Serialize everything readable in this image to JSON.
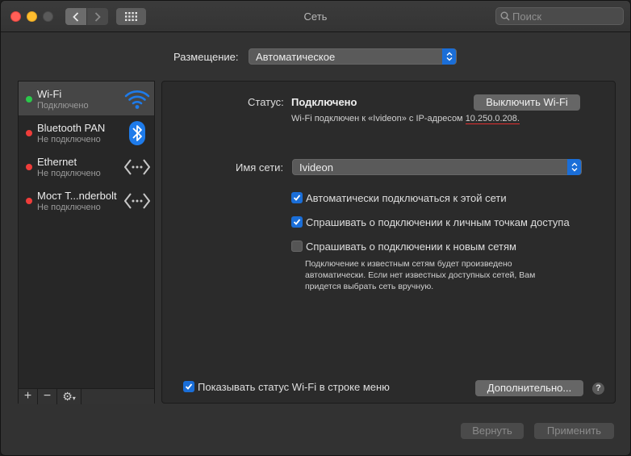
{
  "window": {
    "title": "Сеть"
  },
  "search": {
    "placeholder": "Поиск"
  },
  "location": {
    "label": "Размещение:",
    "value": "Автоматическое"
  },
  "sidebar": {
    "items": [
      {
        "name": "Wi-Fi",
        "status": "Подключено",
        "status_color": "#2ac94a",
        "icon": "wifi-icon"
      },
      {
        "name": "Bluetooth PAN",
        "status": "Не подключено",
        "status_color": "#ef3d3a",
        "icon": "bluetooth-icon"
      },
      {
        "name": "Ethernet",
        "status": "Не подключено",
        "status_color": "#ef3d3a",
        "icon": "ethernet-arrows-icon"
      },
      {
        "name": "Мост T...nderbolt",
        "status": "Не подключено",
        "status_color": "#ef3d3a",
        "icon": "thunderbolt-bridge-arrows-icon"
      }
    ],
    "add_label": "+",
    "remove_label": "−",
    "gear_label": "⚙"
  },
  "detail": {
    "status_label": "Статус:",
    "status_value": "Подключено",
    "toggle_button": "Выключить Wi-Fi",
    "status_desc": "Wi-Fi подключен к «Ivideon» с IP-адресом",
    "ip_address": "10.250.0.208",
    "ip_suffix": ".",
    "network_label": "Имя сети:",
    "network_value": "Ivideon",
    "checkboxes": [
      {
        "label": "Автоматически подключаться к этой сети",
        "checked": true
      },
      {
        "label": "Спрашивать о подключении к личным точкам доступа",
        "checked": true
      },
      {
        "label": "Спрашивать о подключении к новым сетям",
        "checked": false
      }
    ],
    "note_line1": "Подключение к известным сетям будет произведено",
    "note_line2": "автоматически. Если нет известных доступных сетей, Вам",
    "note_line3": "придется выбрать сеть вручную.",
    "show_status_label": "Показывать статус Wi-Fi в строке меню",
    "show_status_checked": true,
    "advanced_button": "Дополнительно...",
    "help_label": "?"
  },
  "footer": {
    "revert_button": "Вернуть",
    "apply_button": "Применить"
  },
  "colors": {
    "accent": "#1a6ed8",
    "connected": "#2ac94a",
    "disconnected": "#ef3d3a"
  }
}
